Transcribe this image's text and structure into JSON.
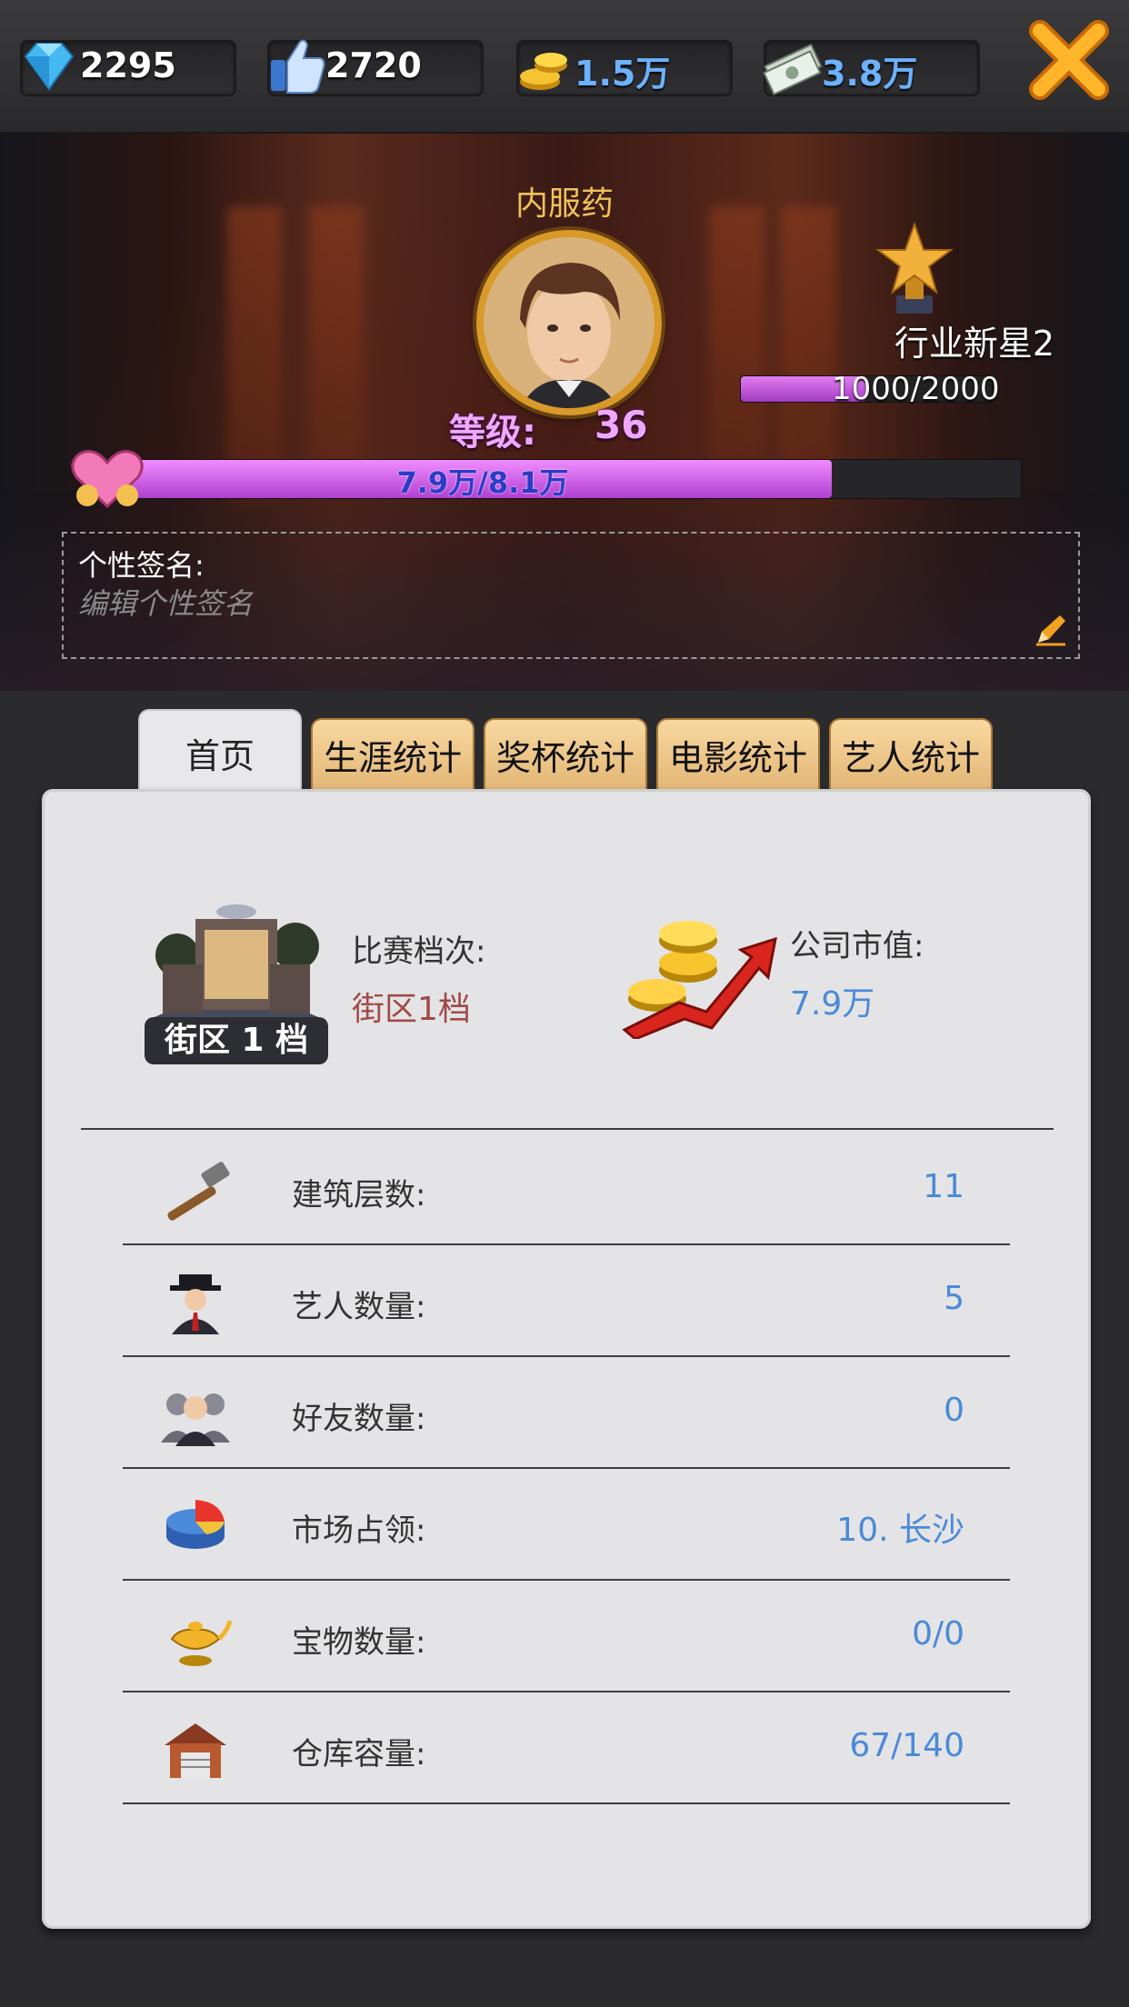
{
  "resources": {
    "diamonds": "2295",
    "likes": "2720",
    "gold": "1.5万",
    "cash": "3.8万"
  },
  "profile": {
    "name": "内服药",
    "level_label": "等级:",
    "level": "36",
    "exp_text": "7.9万/8.1万",
    "exp_progress": 0.79,
    "rank_title": "行业新星2",
    "rank_progress_text": "1000/2000",
    "rank_progress": 0.5,
    "signature_label": "个性签名:",
    "signature_placeholder": "编辑个性签名"
  },
  "tabs": [
    {
      "label": "首页",
      "active": true
    },
    {
      "label": "生涯统计",
      "active": false
    },
    {
      "label": "奖杯统计",
      "active": false
    },
    {
      "label": "电影统计",
      "active": false
    },
    {
      "label": "艺人统计",
      "active": false
    }
  ],
  "summary": {
    "district_badge": "街区 1 档",
    "tier_label": "比赛档次:",
    "tier_value": "街区1档",
    "market_cap_label": "公司市值:",
    "market_cap_value": "7.9万"
  },
  "stats": [
    {
      "icon": "hammer-icon",
      "label": "建筑层数:",
      "value": "11"
    },
    {
      "icon": "agent-icon",
      "label": "艺人数量:",
      "value": "5"
    },
    {
      "icon": "friends-icon",
      "label": "好友数量:",
      "value": "0"
    },
    {
      "icon": "pie-chart-icon",
      "label": "市场占领:",
      "value": "10. 长沙"
    },
    {
      "icon": "magic-lamp-icon",
      "label": "宝物数量:",
      "value": "0/0"
    },
    {
      "icon": "warehouse-icon",
      "label": "仓库容量:",
      "value": "67/140"
    }
  ],
  "colors": {
    "accent_purple": "#c052d8",
    "gold_text": "#f0c25a",
    "value_blue": "#4a8ad8",
    "tier_red": "#a04a46",
    "tab_orange": "#e8c080"
  }
}
